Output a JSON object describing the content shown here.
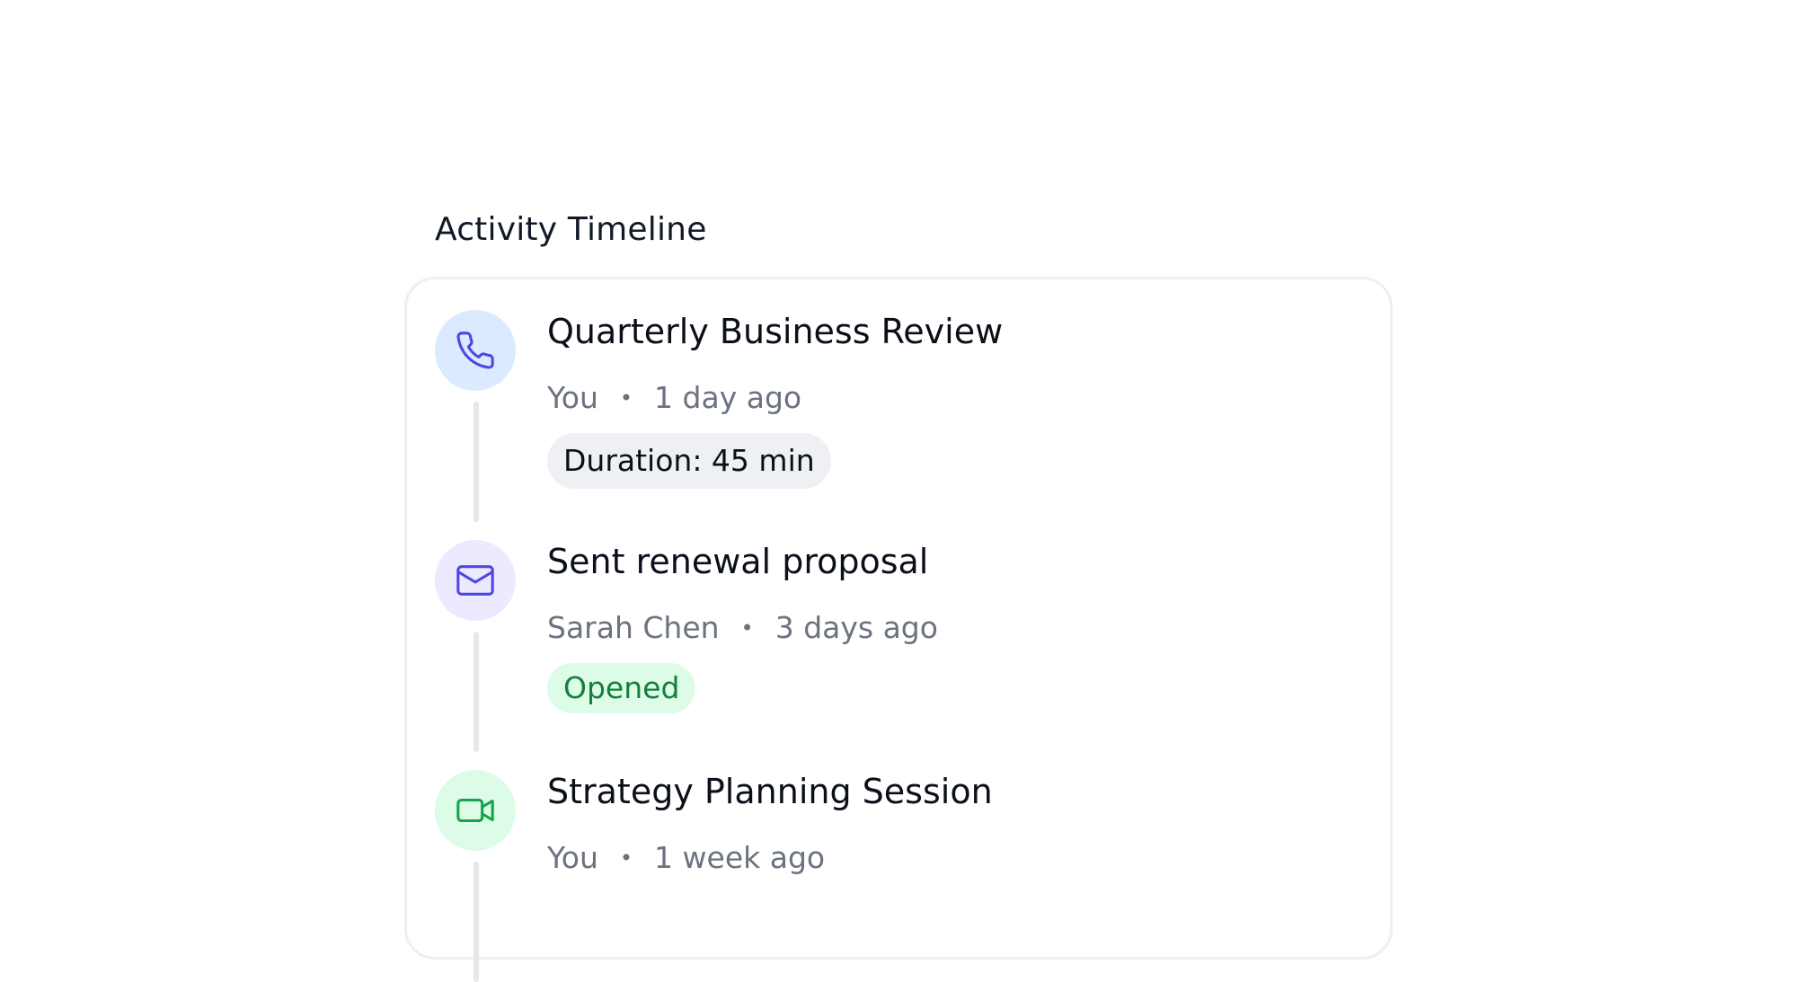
{
  "section_title": "Activity Timeline",
  "colors": {
    "call_bg": "#dbeafe",
    "call_icon": "#4f46e5",
    "email_bg": "#ede9fe",
    "email_icon": "#4f46e5",
    "meeting_bg": "#dcfce7",
    "meeting_icon": "#16a34a"
  },
  "activities": [
    {
      "icon": "phone-icon",
      "title": "Quarterly Business Review",
      "author": "You",
      "separator": "•",
      "time": "1 day ago",
      "badge": "Duration: 45 min"
    },
    {
      "icon": "mail-icon",
      "title": "Sent renewal proposal",
      "author": "Sarah Chen",
      "separator": "•",
      "time": "3 days ago",
      "badge": "Opened"
    },
    {
      "icon": "video-icon",
      "title": "Strategy Planning Session",
      "author": "You",
      "separator": "•",
      "time": "1 week ago"
    }
  ]
}
